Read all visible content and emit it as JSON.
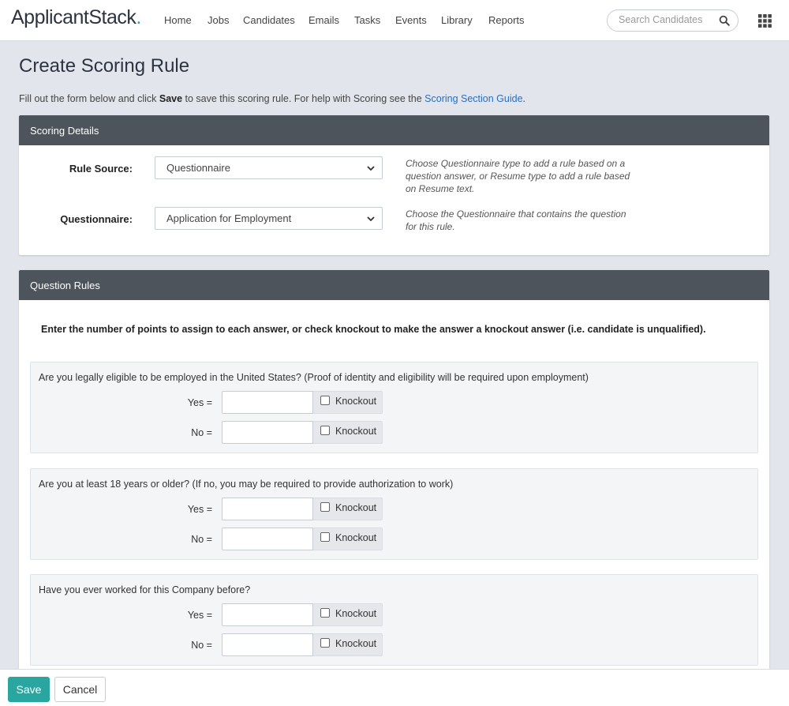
{
  "app": {
    "logo": "ApplicantStack",
    "logo_dot": "."
  },
  "nav": {
    "items": [
      {
        "label": "Home"
      },
      {
        "label": "Jobs"
      },
      {
        "label": "Candidates"
      },
      {
        "label": "Emails"
      },
      {
        "label": "Tasks"
      },
      {
        "label": "Events"
      },
      {
        "label": "Library"
      },
      {
        "label": "Reports"
      }
    ],
    "search_placeholder": "Search Candidates",
    "search_icon": "search-icon",
    "apps_icon": "grid-icon"
  },
  "page": {
    "title": "Create Scoring Rule",
    "help_prefix": "Fill out the form below and click ",
    "help_bold": "Save",
    "help_middle": " to save this scoring rule. For help with Scoring see the ",
    "help_link": "Scoring Section Guide",
    "help_suffix": "."
  },
  "scoring_details": {
    "header": "Scoring Details",
    "rule_source": {
      "label": "Rule Source:",
      "value": "Questionnaire",
      "hint": "Choose Questionnaire type to add a rule based on a question answer, or Resume type to add a rule based on Resume text."
    },
    "questionnaire": {
      "label": "Questionnaire:",
      "value": "Application for Employment",
      "hint": "Choose the Questionnaire that contains the question for this rule."
    }
  },
  "question_rules": {
    "header": "Question Rules",
    "instructions": "Enter the number of points to assign to each answer, or check knockout to make the answer a knockout answer (i.e. candidate is unqualified).",
    "knockout_label": "Knockout",
    "questions": [
      {
        "text": "Are you legally eligible to be employed in the United States? (Proof of identity and eligibility will be required upon employment)",
        "answers": [
          {
            "label": "Yes =",
            "points": "",
            "knockout": false
          },
          {
            "label": "No =",
            "points": "",
            "knockout": false
          }
        ]
      },
      {
        "text": "Are you at least 18 years or older? (If no, you may be required to provide authorization to work)",
        "answers": [
          {
            "label": "Yes =",
            "points": "",
            "knockout": false
          },
          {
            "label": "No =",
            "points": "",
            "knockout": false
          }
        ]
      },
      {
        "text": "Have you ever worked for this Company before?",
        "answers": [
          {
            "label": "Yes =",
            "points": "",
            "knockout": false
          },
          {
            "label": "No =",
            "points": "",
            "knockout": false
          }
        ]
      }
    ]
  },
  "footer": {
    "save_label": "Save",
    "cancel_label": "Cancel"
  },
  "colors": {
    "accent": "#2aa6a0",
    "header_bar": "#4e545c",
    "link": "#2a6ebb",
    "page_bg": "#e2e6ec"
  }
}
